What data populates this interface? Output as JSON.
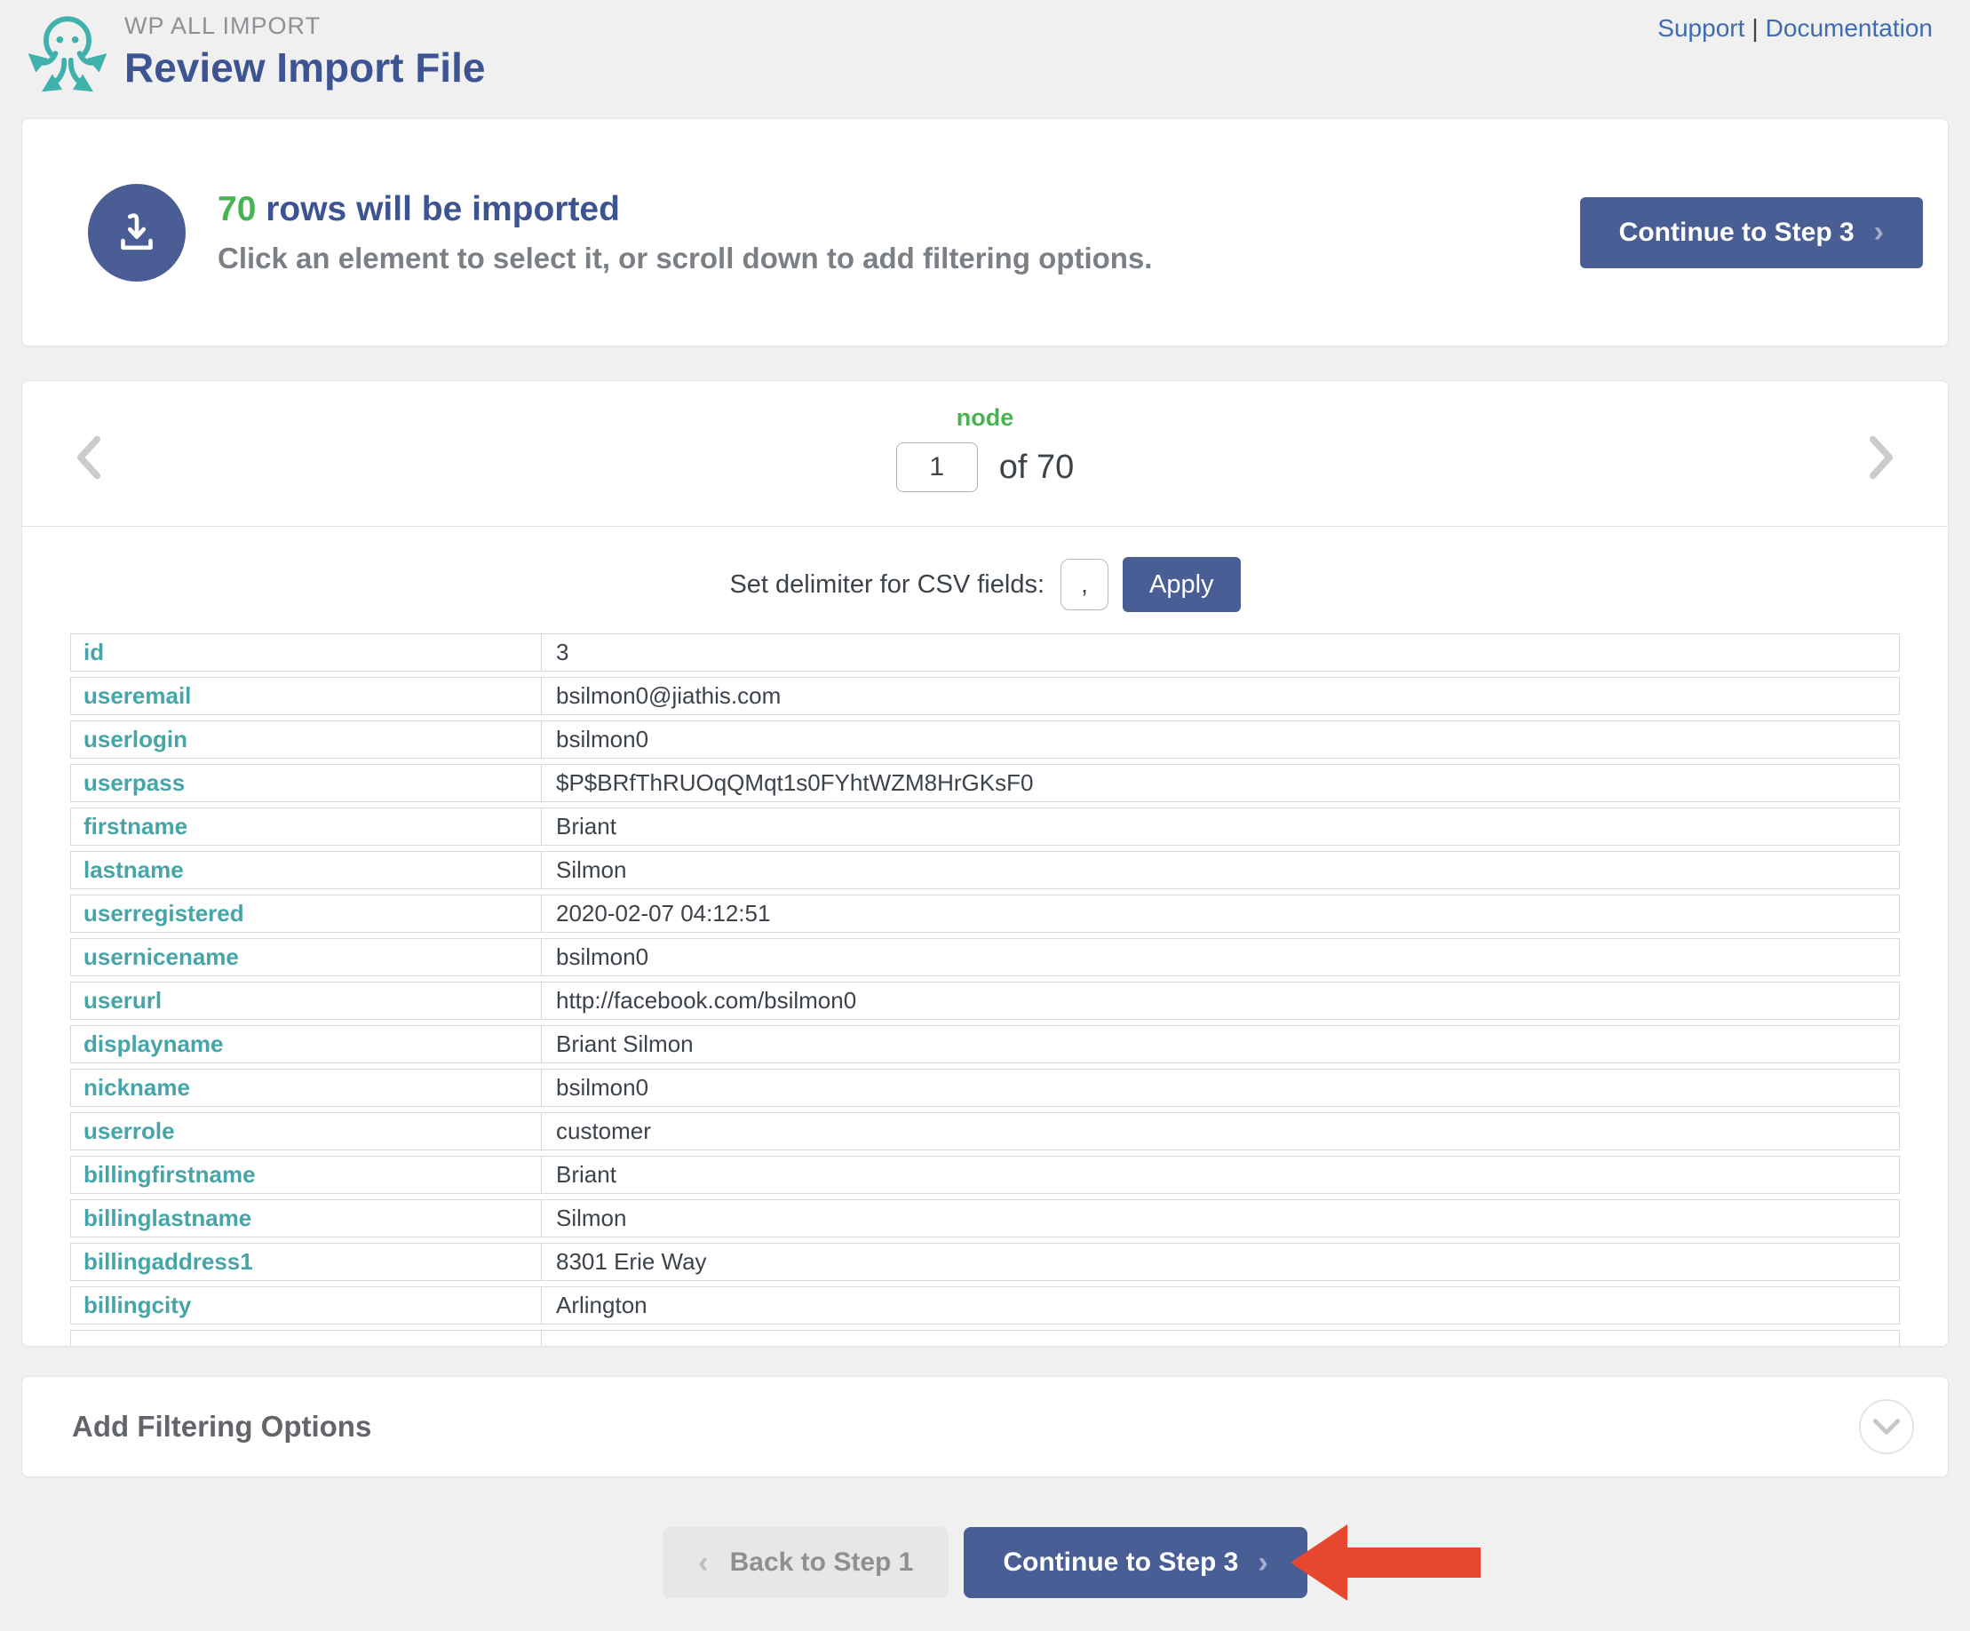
{
  "header": {
    "brand": "WP ALL IMPORT",
    "page_title": "Review Import File",
    "support_link": "Support",
    "links_separator": "|",
    "documentation_link": "Documentation"
  },
  "banner": {
    "rows_count": "70",
    "title_rest": " rows will be imported",
    "subtitle": "Click an element to select it, or scroll down to add filtering options.",
    "continue_button": "Continue to Step 3",
    "continue_chevron": "›"
  },
  "navigator": {
    "node_label": "node",
    "current_page": "1",
    "of_label": "of 70"
  },
  "delimiter": {
    "label": "Set delimiter for CSV fields:",
    "value": ",",
    "apply_button": "Apply"
  },
  "record_table": {
    "rows": [
      {
        "field": "id",
        "value": "3"
      },
      {
        "field": "useremail",
        "value": "bsilmon0@jiathis.com"
      },
      {
        "field": "userlogin",
        "value": "bsilmon0"
      },
      {
        "field": "userpass",
        "value": "$P$BRfThRUOqQMqt1s0FYhtWZM8HrGKsF0"
      },
      {
        "field": "firstname",
        "value": "Briant"
      },
      {
        "field": "lastname",
        "value": "Silmon"
      },
      {
        "field": "userregistered",
        "value": "2020-02-07 04:12:51"
      },
      {
        "field": "usernicename",
        "value": "bsilmon0"
      },
      {
        "field": "userurl",
        "value": "http://facebook.com/bsilmon0"
      },
      {
        "field": "displayname",
        "value": "Briant Silmon"
      },
      {
        "field": "nickname",
        "value": "bsilmon0"
      },
      {
        "field": "userrole",
        "value": "customer"
      },
      {
        "field": "billingfirstname",
        "value": "Briant"
      },
      {
        "field": "billinglastname",
        "value": "Silmon"
      },
      {
        "field": "billingaddress1",
        "value": "8301 Erie Way"
      },
      {
        "field": "billingcity",
        "value": "Arlington"
      }
    ]
  },
  "filtering": {
    "title": "Add Filtering Options"
  },
  "footer": {
    "back_button": "Back to Step 1",
    "back_chevron": "‹",
    "continue_button": "Continue to Step 3",
    "continue_chevron": "›"
  },
  "icons": {
    "logo": "octopus-logo",
    "banner": "import-download-icon",
    "nav_left": "chevron-left-icon",
    "nav_right": "chevron-right-icon",
    "filter_toggle": "chevron-down-icon",
    "annotation": "red-arrow-left"
  },
  "colors": {
    "accent_blue": "#4a5e96",
    "title_blue": "#3d5493",
    "green": "#46b450",
    "teal": "#45a5a8",
    "link_blue": "#3f6cb0",
    "red_arrow": "#e8472f",
    "page_bg": "#f0f0f1"
  }
}
